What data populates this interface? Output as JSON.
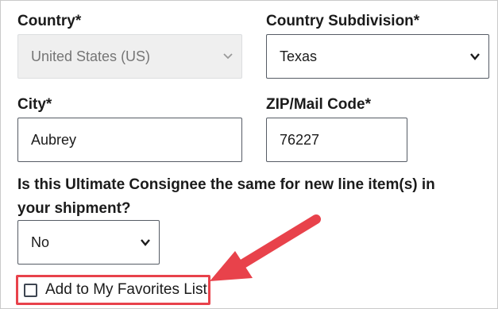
{
  "country": {
    "label": "Country*",
    "value": "United States (US)",
    "disabled": true
  },
  "subdivision": {
    "label": "Country Subdivision*",
    "value": "Texas"
  },
  "city": {
    "label": "City*",
    "value": "Aubrey"
  },
  "zip": {
    "label": "ZIP/Mail Code*",
    "value": "76227"
  },
  "same_consignee": {
    "question": "Is this Ultimate Consignee the same for new line item(s) in your shipment?",
    "value": "No"
  },
  "favorites": {
    "label": "Add to My Favorites List",
    "checked": false
  },
  "annotation": {
    "color": "#e8424b"
  }
}
